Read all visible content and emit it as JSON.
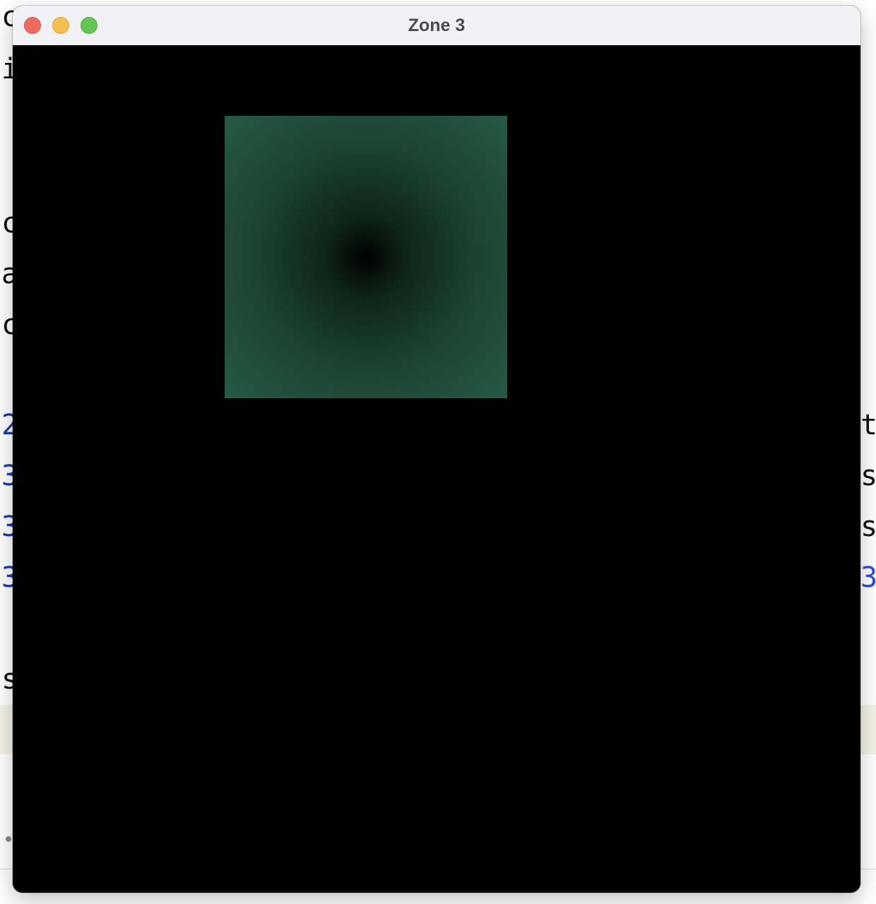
{
  "window": {
    "title": "Zone 3"
  },
  "content": {
    "background_color": "#000000",
    "square_center_color": "#000000",
    "square_edge_color": "#265a45"
  },
  "background_editor": {
    "left_column_chars": [
      "c",
      "i",
      "c",
      "a",
      "c",
      "2",
      "3",
      "3",
      "3",
      "s"
    ],
    "right_column_chars": [
      "t",
      "s",
      "s",
      "3"
    ]
  },
  "icons": {
    "close": "close-icon",
    "minimize": "minimize-icon",
    "zoom": "zoom-icon"
  }
}
